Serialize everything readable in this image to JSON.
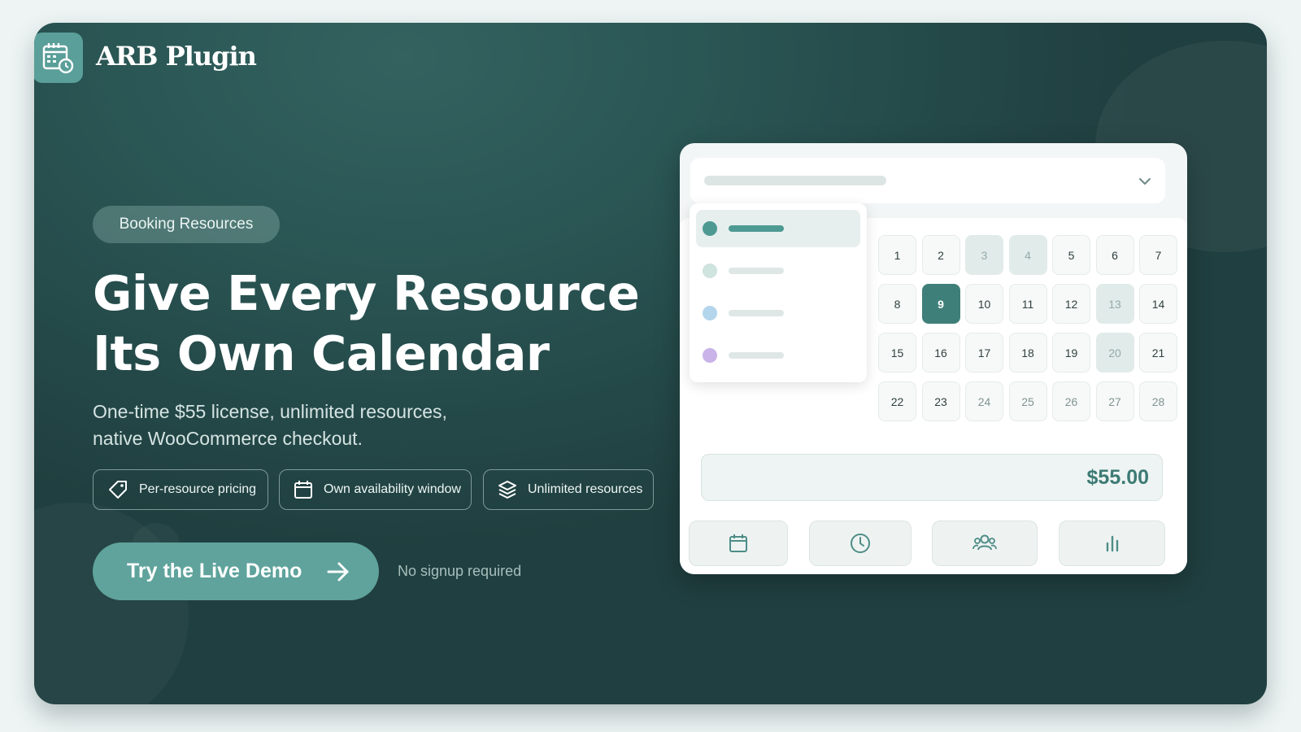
{
  "brand": {
    "name": "ARB Plugin",
    "icon": "calendar-clock-icon"
  },
  "hero": {
    "tag": "Booking Resources",
    "headline_line1": "Give Every Resource",
    "headline_line2": "Its Own Calendar",
    "subline_line1": "One-time $55 license, unlimited resources,",
    "subline_line2": "native WooCommerce checkout.",
    "features": [
      {
        "label": "Per-resource pricing",
        "icon": "price-tag-icon"
      },
      {
        "label": "Own availability window",
        "icon": "calendar-icon"
      },
      {
        "label": "Unlimited resources",
        "icon": "layers-icon"
      }
    ],
    "cta_label": "Try the Live Demo",
    "cta_note": "No signup required"
  },
  "mockup": {
    "dropdown_items": [
      {
        "color": "#4e9a93",
        "selected": true
      },
      {
        "color": "#cfe3df",
        "selected": false
      },
      {
        "color": "#b4d6ec",
        "selected": false
      },
      {
        "color": "#c9b3e8",
        "selected": false
      }
    ],
    "days": [
      "1",
      "2",
      "3",
      "4",
      "5",
      "6",
      "7",
      "8",
      "9",
      "10",
      "11",
      "12",
      "13",
      "14",
      "15",
      "16",
      "17",
      "18",
      "19",
      "20",
      "21",
      "22",
      "23",
      "24",
      "25",
      "26",
      "27",
      "28"
    ],
    "selected_day": "9",
    "unavailable_days": [
      "3",
      "4",
      "13",
      "20"
    ],
    "muted_days": [
      "24",
      "25",
      "26",
      "27",
      "28"
    ],
    "price": "$55.00",
    "tab_icons": [
      "calendar-icon",
      "clock-icon",
      "users-icon",
      "bar-chart-icon"
    ]
  },
  "colors": {
    "accent": "#5fa39c",
    "accent_dark": "#3f7f79",
    "bg_dark": "#244848"
  }
}
